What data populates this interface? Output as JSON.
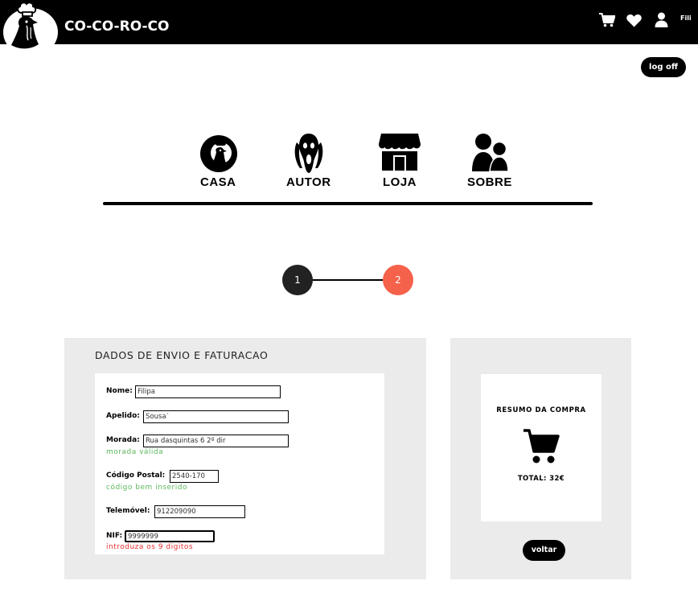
{
  "header": {
    "brand": "CO-CO-RO-CO",
    "user_name": "Fili",
    "icons": [
      "cart-icon",
      "heart-icon",
      "user-icon"
    ]
  },
  "logoff_label": "log off",
  "nav": {
    "items": [
      {
        "label": "CASA",
        "icon": "rooster-circle-icon"
      },
      {
        "label": "AUTOR",
        "icon": "scream-face-icon"
      },
      {
        "label": "LOJA",
        "icon": "shop-icon"
      },
      {
        "label": "SOBRE",
        "icon": "people-icon"
      }
    ]
  },
  "steps": [
    "1",
    "2"
  ],
  "active_step": "2",
  "form": {
    "title": "DADOS DE ENVIO E FATURACAO",
    "fields": [
      {
        "label": "Nome:",
        "value": "Filipa"
      },
      {
        "label": "Apelido:",
        "value": "Sousa`"
      },
      {
        "label": "Morada:",
        "value": "Rua dasquintas 6 2º dir",
        "message": "morada válida"
      },
      {
        "label": "Código Postal:",
        "value": "2540-170",
        "message": "código bem inserido"
      },
      {
        "label": "Telemóvel:",
        "value": "912209090"
      },
      {
        "label": "NIF:",
        "value": "9999999",
        "error": "introduza os 9 digitos"
      }
    ]
  },
  "summary": {
    "title": "RESUMO DA COMPRA",
    "total": "TOTAL: 32€",
    "back_label": "voltar"
  },
  "colors": {
    "accent": "#f5614a",
    "ok": "#5cb85c",
    "error": "#e8302f",
    "panel": "#ebebeb"
  }
}
